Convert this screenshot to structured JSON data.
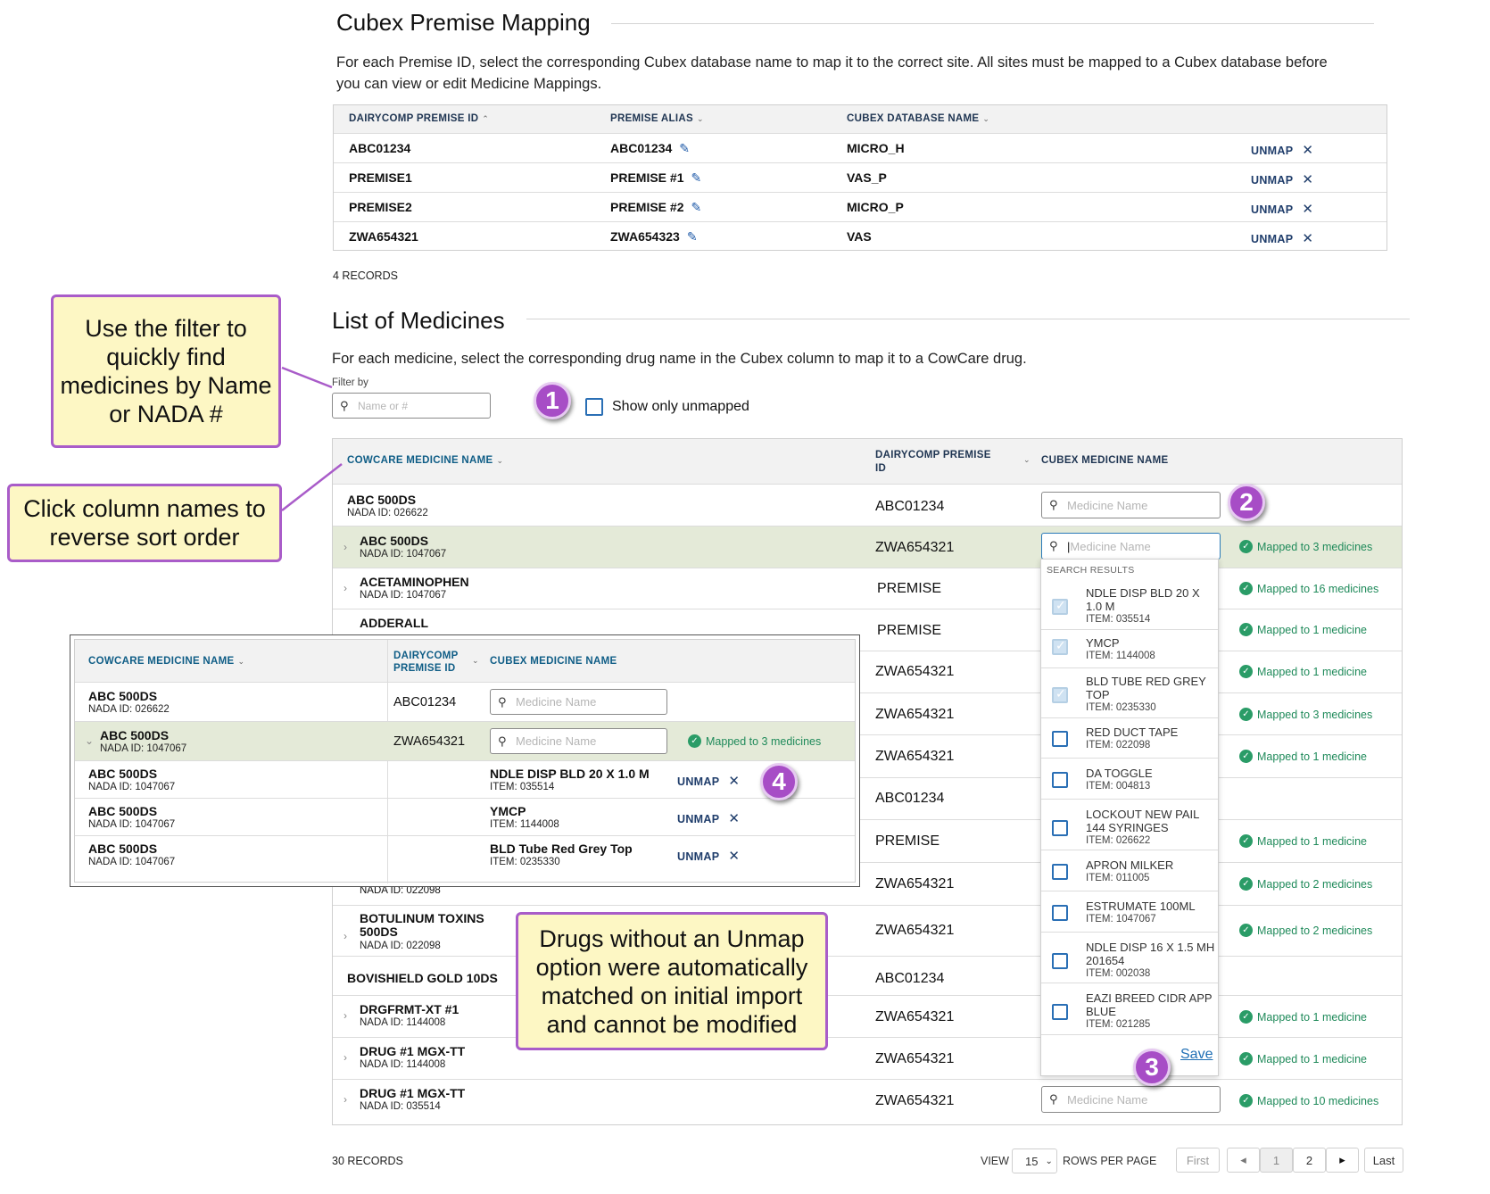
{
  "premise_mapping": {
    "title": "Cubex Premise Mapping",
    "description": "For each Premise ID, select the corresponding Cubex database name to map it to the correct site. All sites must be mapped to a Cubex database before you can view or edit Medicine Mappings.",
    "columns": {
      "premise_id": "DAIRYCOMP PREMISE ID",
      "alias": "PREMISE ALIAS",
      "database": "CUBEX DATABASE NAME"
    },
    "rows": [
      {
        "premise_id": "ABC01234",
        "alias": "ABC01234",
        "database": "MICRO_H",
        "action": "UNMAP"
      },
      {
        "premise_id": "PREMISE1",
        "alias": "PREMISE #1",
        "database": "VAS_P",
        "action": "UNMAP"
      },
      {
        "premise_id": "PREMISE2",
        "alias": "PREMISE #2",
        "database": "MICRO_P",
        "action": "UNMAP"
      },
      {
        "premise_id": "ZWA654321",
        "alias": "ZWA654323",
        "database": "VAS",
        "action": "UNMAP"
      }
    ],
    "records": "4 RECORDS"
  },
  "medicines": {
    "title": "List of Medicines",
    "description": "For each medicine, select the corresponding drug name in the Cubex column to map it to a CowCare drug.",
    "filter_label": "Filter by",
    "filter_placeholder": "Name or #",
    "show_unmapped": "Show only unmapped",
    "columns": {
      "name": "COWCARE MEDICINE NAME",
      "premise_line1": "DAIRYCOMP PREMISE",
      "premise_line2": "ID",
      "cubex": "CUBEX MEDICINE NAME"
    },
    "search_placeholder": "Medicine Name",
    "rows": [
      {
        "name": "ABC 500DS",
        "nada": "NADA ID: 026622",
        "premise": "ABC01234",
        "mapped": ""
      },
      {
        "name": "ABC 500DS",
        "nada": "NADA ID: 1047067",
        "premise": "ZWA654321",
        "mapped": "Mapped to 3 medicines"
      },
      {
        "name": "ACETAMINOPHEN",
        "nada": "NADA ID: 1047067",
        "premise": "PREMISE",
        "mapped": "Mapped to 16 medicines"
      },
      {
        "name": "ADDERALL",
        "nada": "",
        "premise": "PREMISE",
        "mapped": "Mapped to 1 medicine"
      },
      {
        "name": "",
        "nada": "",
        "premise": "ZWA654321",
        "mapped": "Mapped to 1 medicine"
      },
      {
        "name": "",
        "nada": "",
        "premise": "ZWA654321",
        "mapped": "Mapped to 3 medicines"
      },
      {
        "name": "",
        "nada": "",
        "premise": "ZWA654321",
        "mapped": "Mapped to 1 medicine"
      },
      {
        "name": "",
        "nada": "",
        "premise": "ABC01234",
        "mapped": ""
      },
      {
        "name": "",
        "nada": "",
        "premise": "PREMISE",
        "mapped": "Mapped to 1 medicine"
      },
      {
        "name": "",
        "nada": "NADA ID: 022098",
        "premise": "ZWA654321",
        "mapped": "Mapped to 2 medicines"
      },
      {
        "name": "BOTULINUM TOXINS 500DS",
        "nada": "NADA ID: 022098",
        "premise": "ZWA654321",
        "mapped": "Mapped to 2 medicines"
      },
      {
        "name": "BOVISHIELD GOLD 10DS",
        "nada": "",
        "premise": "ABC01234",
        "mapped": ""
      },
      {
        "name": "DRGFRMT-XT #1",
        "nada": "NADA ID: 1144008",
        "premise": "ZWA654321",
        "mapped": "Mapped to 1 medicine"
      },
      {
        "name": "DRUG #1 MGX-TT",
        "nada": "NADA ID: 1144008",
        "premise": "ZWA654321",
        "mapped": "Mapped to 1 medicine"
      },
      {
        "name": "DRUG #1 MGX-TT",
        "nada": "NADA ID: 035514",
        "premise": "ZWA654321",
        "mapped": "Mapped to 10 medicines"
      }
    ],
    "dropdown": {
      "header": "SEARCH RESULTS",
      "items": [
        {
          "name": "NDLE DISP BLD 20 X 1.0 M",
          "item": "ITEM: 035514",
          "checked": true
        },
        {
          "name": "YMCP",
          "item": "ITEM: 1144008",
          "checked": true
        },
        {
          "name": "BLD TUBE RED GREY TOP",
          "item": "ITEM: 0235330",
          "checked": true
        },
        {
          "name": "RED DUCT TAPE",
          "item": "ITEM: 022098",
          "checked": false
        },
        {
          "name": "DA TOGGLE",
          "item": "ITEM: 004813",
          "checked": false
        },
        {
          "name": "LOCKOUT NEW PAIL 144 SYRINGES",
          "item": "ITEM: 026622",
          "checked": false
        },
        {
          "name": "APRON MILKER",
          "item": "ITEM: 011005",
          "checked": false
        },
        {
          "name": "ESTRUMATE 100ML",
          "item": "ITEM: 1047067",
          "checked": false
        },
        {
          "name": "NDLE DISP 16 X 1.5 MH 201654",
          "item": "ITEM: 002038",
          "checked": false
        },
        {
          "name": "EAZI BREED CIDR APP BLUE",
          "item": "ITEM: 021285",
          "checked": false
        }
      ],
      "save": "Save"
    },
    "records": "30 RECORDS",
    "pagination": {
      "view": "VIEW",
      "per_page": "15",
      "rows_per_page": "ROWS PER PAGE",
      "first": "First",
      "page1": "1",
      "page2": "2",
      "last": "Last"
    }
  },
  "inset": {
    "columns": {
      "name": "COWCARE MEDICINE NAME",
      "premise_line1": "DAIRYCOMP",
      "premise_line2": "PREMISE ID",
      "cubex": "CUBEX MEDICINE NAME"
    },
    "rows": [
      {
        "name": "ABC 500DS",
        "nada": "NADA ID: 026622",
        "premise": "ABC01234"
      },
      {
        "name": "ABC 500DS",
        "nada": "NADA ID: 1047067",
        "premise": "ZWA654321",
        "mapped": "Mapped to 3 medicines"
      }
    ],
    "children": [
      {
        "name": "ABC 500DS",
        "nada": "NADA ID: 1047067",
        "drug": "NDLE DISP BLD 20 X 1.0 M",
        "item": "ITEM: 035514",
        "action": "UNMAP"
      },
      {
        "name": "ABC 500DS",
        "nada": "NADA ID: 1047067",
        "drug": "YMCP",
        "item": "ITEM: 1144008",
        "action": "UNMAP"
      },
      {
        "name": "ABC 500DS",
        "nada": "NADA ID: 1047067",
        "drug": "BLD Tube Red Grey Top",
        "item": "ITEM: 0235330",
        "action": "UNMAP"
      }
    ]
  },
  "callouts": {
    "filter": "Use the filter to quickly find medicines by Name or NADA #",
    "sort": "Click column names to reverse sort order",
    "auto": "Drugs without an Unmap option were automatically matched on initial import and cannot be modified",
    "n1": "1",
    "n2": "2",
    "n3": "3",
    "n4": "4"
  },
  "colors": {
    "accent_teal": "#0f5d86",
    "mapped_green": "#2a9c67",
    "callout_bg": "#fdf7c4",
    "callout_border": "#a95cc9",
    "highlight_row": "#e4ead8"
  },
  "icons": [
    "pencil-icon",
    "close-icon",
    "search-icon",
    "check-circle-icon",
    "chevron-right-icon",
    "chevron-down-icon",
    "sort-asc-icon"
  ]
}
